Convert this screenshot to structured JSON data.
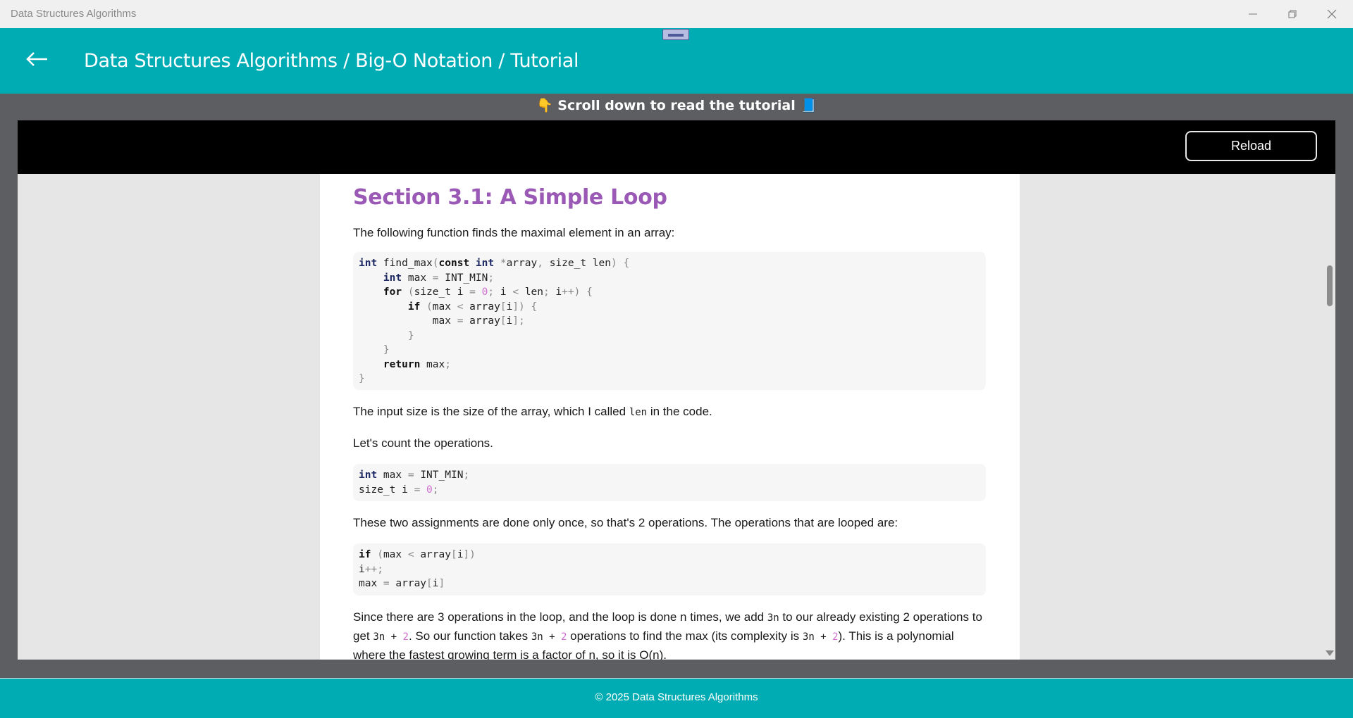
{
  "window": {
    "title": "Data Structures Algorithms",
    "controls": [
      "minimize-icon",
      "restore-icon",
      "close-icon"
    ]
  },
  "header": {
    "back_icon": "arrow-left-icon",
    "breadcrumb": "Data Structures Algorithms / Big-O Notation / Tutorial"
  },
  "hint": {
    "text": "👇 Scroll down to read the tutorial 📘"
  },
  "toolbar": {
    "reload_label": "Reload"
  },
  "article": {
    "heading": "Section 3.1: A Simple Loop",
    "intro": "The following function finds the maximal element in an array:",
    "p2_before": "The input size is the size of the array, which I called ",
    "p2_code": "len",
    "p2_after": " in the code.",
    "p3": "Let's count the operations.",
    "p4": "These two assignments are done only once, so that's 2 operations. The operations that are looped are:",
    "p5_a": "Since there are 3 operations in the loop, and the loop is done n times, we add ",
    "p5_code1": "3n",
    "p5_b": " to our already existing 2 operations to get ",
    "p5_code2": "3n + 2",
    "p5_c": ". So our function takes ",
    "p5_code3": "3n + 2",
    "p5_d": " operations to find the max (its complexity is ",
    "p5_code4": "3n + 2",
    "p5_e": "). This is a polynomial where the fastest growing term is a factor of n, so it is O(n)."
  },
  "footer": {
    "text": "© 2025 Data Structures Algorithms"
  },
  "colors": {
    "accent": "#00acb4",
    "heading": "#9b59b6",
    "number": "#d16fd1"
  }
}
